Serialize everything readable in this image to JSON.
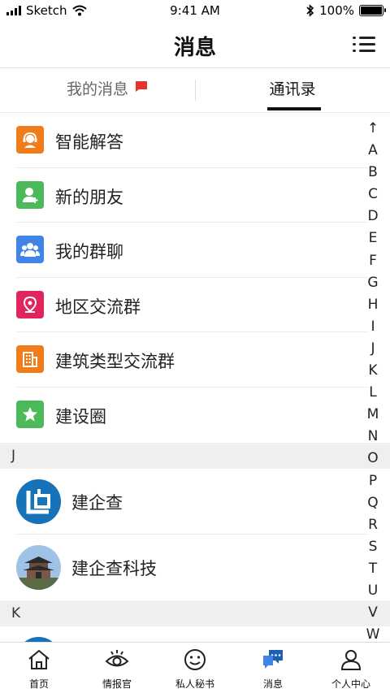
{
  "status_bar": {
    "carrier": "Sketch",
    "time": "9:41 AM",
    "battery": "100%"
  },
  "header": {
    "title": "消息"
  },
  "tabs": [
    {
      "label": "我的消息",
      "badge": "New",
      "active": false
    },
    {
      "label": "通讯录",
      "active": true
    }
  ],
  "menu_items": [
    {
      "label": "智能解答",
      "icon": "customer-service-icon",
      "color": "#f07c1a"
    },
    {
      "label": "新的朋友",
      "icon": "add-friend-icon",
      "color": "#4cba5a"
    },
    {
      "label": "我的群聊",
      "icon": "group-chat-icon",
      "color": "#3f84e6"
    },
    {
      "label": "地区交流群",
      "icon": "location-pin-icon",
      "color": "#e0245e"
    },
    {
      "label": "建筑类型交流群",
      "icon": "building-icon",
      "color": "#f07c1a"
    },
    {
      "label": "建设圈",
      "icon": "star-icon",
      "color": "#4cba5a"
    }
  ],
  "sections": [
    {
      "letter": "J",
      "contacts": [
        {
          "name": "建企查",
          "avatar": "jianqicha-logo-avatar"
        },
        {
          "name": "建企查科技",
          "avatar": "pagoda-photo-avatar"
        }
      ]
    },
    {
      "letter": "K",
      "contacts": []
    }
  ],
  "alpha_index": [
    "↑",
    "A",
    "B",
    "C",
    "D",
    "E",
    "F",
    "G",
    "H",
    "I",
    "J",
    "K",
    "L",
    "M",
    "N",
    "O",
    "P",
    "Q",
    "R",
    "S",
    "T",
    "U",
    "V",
    "W"
  ],
  "tab_bar": [
    {
      "label": "首页",
      "icon": "home-icon"
    },
    {
      "label": "情报官",
      "icon": "eye-icon"
    },
    {
      "label": "私人秘书",
      "icon": "smiley-icon"
    },
    {
      "label": "消息",
      "icon": "chat-bubbles-icon",
      "active": true
    },
    {
      "label": "个人中心",
      "icon": "person-icon"
    }
  ],
  "colors": {
    "active_tab": "#111111",
    "badge": "#e8312b",
    "active_nav_icon": "#3f84e6"
  }
}
